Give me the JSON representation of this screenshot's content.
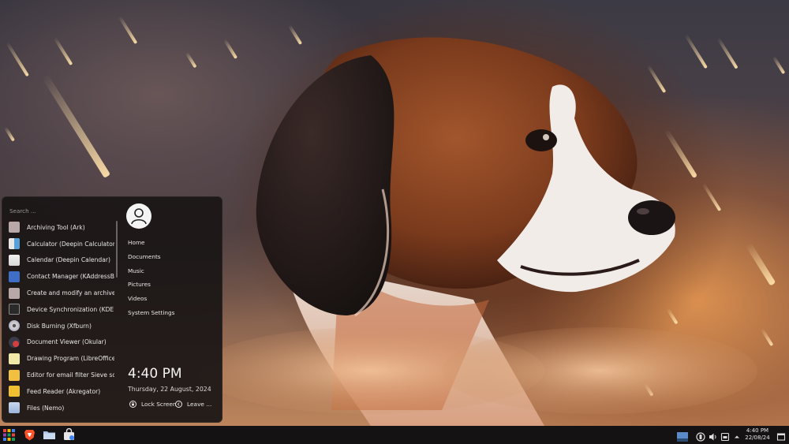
{
  "menu": {
    "search_placeholder": "Search ...",
    "apps": [
      {
        "label": "Archiving Tool (Ark)",
        "icon": "archive-icon"
      },
      {
        "label": "Calculator (Deepin Calculator)",
        "icon": "calculator-icon"
      },
      {
        "label": "Calendar (Deepin Calendar)",
        "icon": "calendar-icon"
      },
      {
        "label": "Contact Manager (KAddressBo...",
        "icon": "contacts-icon"
      },
      {
        "label": "Create and modify an archive (...",
        "icon": "archive-icon"
      },
      {
        "label": "Device Synchronization (KDE C...",
        "icon": "kdeconnect-icon"
      },
      {
        "label": "Disk Burning (Xfburn)",
        "icon": "disc-icon"
      },
      {
        "label": "Document Viewer (Okular)",
        "icon": "okular-icon"
      },
      {
        "label": "Drawing Program (LibreOffice ...",
        "icon": "libreoffice-draw-icon"
      },
      {
        "label": "Editor for email filter Sieve scri...",
        "icon": "sieve-editor-icon"
      },
      {
        "label": "Feed Reader (Akregator)",
        "icon": "akregator-icon"
      },
      {
        "label": "Files (Nemo)",
        "icon": "folder-icon"
      }
    ],
    "places": [
      "Home",
      "Documents",
      "Music",
      "Pictures",
      "Videos",
      "System Settings"
    ],
    "time": "4:40 PM",
    "date": "Thursday, 22 August, 2024",
    "lock_label": "Lock Screen",
    "leave_label": "Leave ..."
  },
  "taskbar": {
    "time": "4:40 PM",
    "date": "22/08/24",
    "pinned": [
      "app-grid-icon",
      "brave-icon",
      "file-manager-icon",
      "software-store-icon"
    ]
  },
  "colors": {
    "menu_bg": "#1a1616",
    "taskbar_bg": "#141212"
  }
}
